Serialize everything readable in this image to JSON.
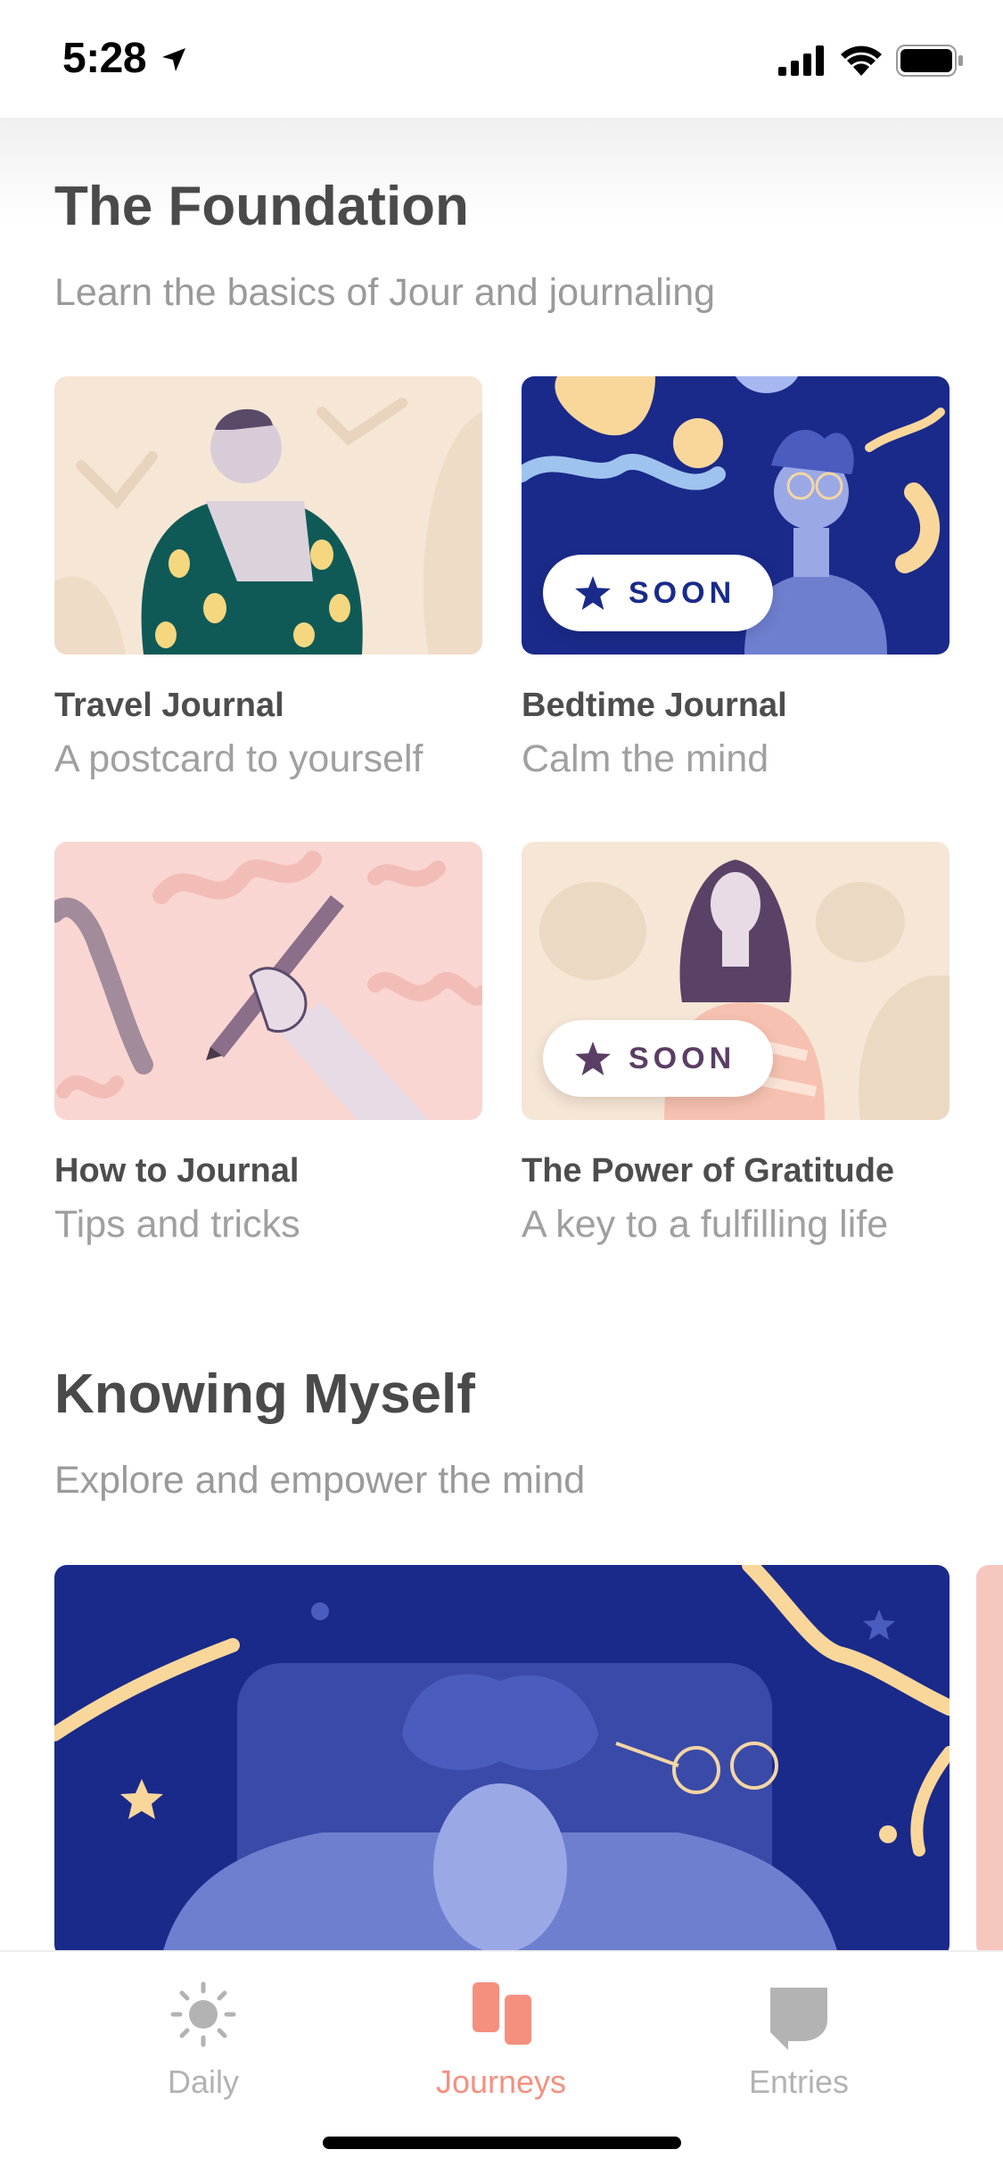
{
  "status_bar": {
    "time": "5:28"
  },
  "sections": [
    {
      "title": "The Foundation",
      "subtitle": "Learn the basics of Jour and journaling",
      "cards": [
        {
          "title": "Travel Journal",
          "subtitle": "A postcard to yourself"
        },
        {
          "title": "Bedtime Journal",
          "subtitle": "Calm the mind",
          "badge": "SOON"
        },
        {
          "title": "How to Journal",
          "subtitle": "Tips and tricks"
        },
        {
          "title": "The Power of Gratitude",
          "subtitle": "A key to a fulfilling life",
          "badge": "SOON"
        }
      ]
    },
    {
      "title": "Knowing Myself",
      "subtitle": "Explore and empower the mind"
    }
  ],
  "tab_bar": {
    "tabs": [
      {
        "label": "Daily",
        "icon": "sun-icon"
      },
      {
        "label": "Journeys",
        "icon": "journeys-icon",
        "active": true
      },
      {
        "label": "Entries",
        "icon": "speech-bubble-icon"
      }
    ]
  },
  "colors": {
    "accent": "#f5907f",
    "navy": "#1a2a8a",
    "text_dark": "#4a4a4a",
    "text_muted": "#9a9a9a",
    "tab_inactive": "#b3b3b3"
  }
}
